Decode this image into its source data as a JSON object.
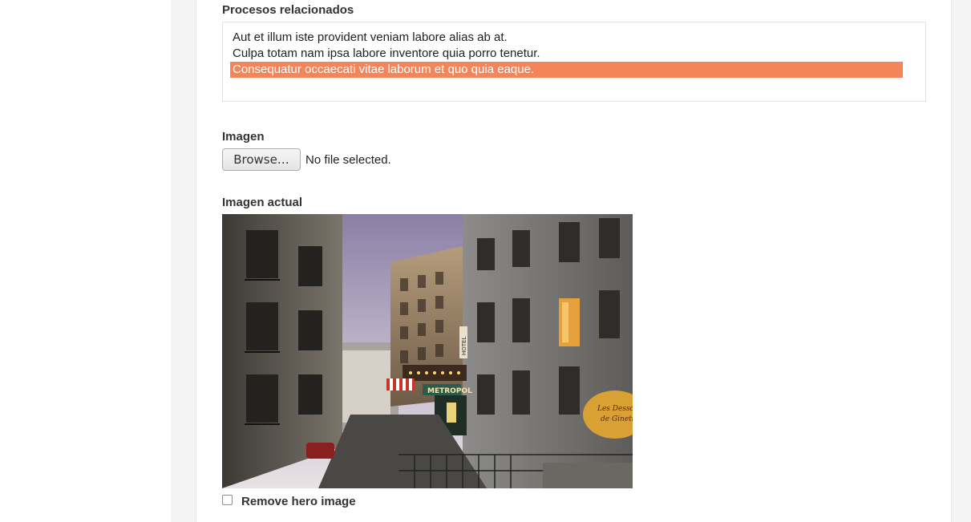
{
  "related_processes": {
    "label": "Procesos relacionados",
    "options": [
      "Aut et illum iste provident veniam labore alias ab at.",
      "Culpa totam nam ipsa labore inventore quia porro tenetur.",
      "Consequatur occaecati vitae laborum et quo quia eaque."
    ],
    "selected_color": "#f3855a"
  },
  "image_upload": {
    "label": "Imagen",
    "browse_label": "Browse…",
    "status": "No file selected."
  },
  "current_image": {
    "label": "Imagen actual",
    "sign_text": "METROPOL",
    "hotel_text": "HOTEL",
    "awning_text_1": "Les Dessous",
    "awning_text_2": "de Ginette"
  },
  "remove_image": {
    "label": "Remove hero image",
    "checked": false
  }
}
